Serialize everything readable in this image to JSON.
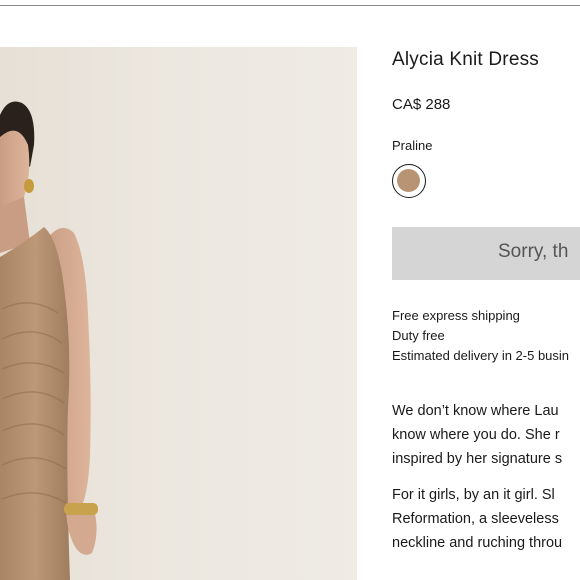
{
  "product": {
    "title": "Alycia Knit Dress",
    "price": "CA$ 288",
    "color_label": "Praline",
    "swatch_color": "#b99474",
    "cta_label": "Sorry, th"
  },
  "shipping": {
    "lines": [
      "Free express shipping",
      "Duty free",
      "Estimated delivery in 2-5 busin"
    ]
  },
  "description": {
    "lines": [
      "We don’t know where Lau",
      "know where you do. She r",
      "inspired by her signature s",
      "For it girls, by an it girl. Sl",
      "Reformation, a sleeveless",
      "neckline and ruching throu"
    ]
  },
  "colors": {
    "dress": "#b38f6f",
    "background": "#ece7df",
    "cta_bg": "#d5d5d5"
  }
}
